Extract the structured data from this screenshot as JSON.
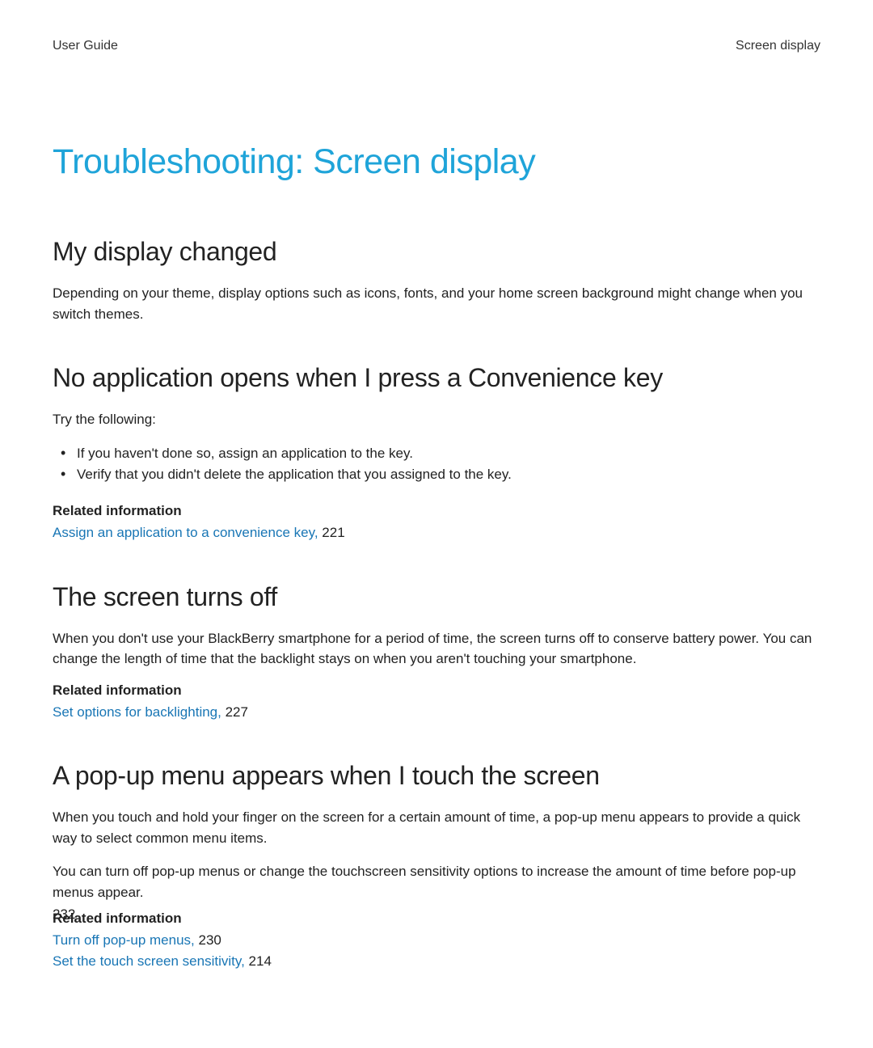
{
  "header": {
    "left": "User Guide",
    "right": "Screen display"
  },
  "main_heading": "Troubleshooting: Screen display",
  "sections": {
    "s1": {
      "heading": "My display changed",
      "body": "Depending on your theme, display options such as icons, fonts, and your home screen background might change when you switch themes."
    },
    "s2": {
      "heading": "No application opens when I press a Convenience key",
      "intro": "Try the following:",
      "bullets": [
        "If you haven't done so, assign an application to the key.",
        "Verify that you didn't delete the application that you assigned to the key."
      ],
      "related_heading": "Related information",
      "related": [
        {
          "link_text": "Assign an application to a convenience key,",
          "page": "221"
        }
      ]
    },
    "s3": {
      "heading": "The screen turns off",
      "body": "When you don't use your BlackBerry smartphone for a period of time, the screen turns off to conserve battery power. You can change the length of time that the backlight stays on when you aren't touching your smartphone.",
      "related_heading": "Related information",
      "related": [
        {
          "link_text": "Set options for backlighting,",
          "page": "227"
        }
      ]
    },
    "s4": {
      "heading": "A pop-up menu appears when I touch the screen",
      "body1": "When you touch and hold your finger on the screen for a certain amount of time, a pop-up menu appears to provide a quick way to select common menu items.",
      "body2": "You can turn off pop-up menus or change the touchscreen sensitivity options to increase the amount of time before pop-up menus appear.",
      "related_heading": "Related information",
      "related": [
        {
          "link_text": "Turn off pop-up menus,",
          "page": "230"
        },
        {
          "link_text": "Set the touch screen sensitivity,",
          "page": "214"
        }
      ]
    }
  },
  "page_number": "232"
}
